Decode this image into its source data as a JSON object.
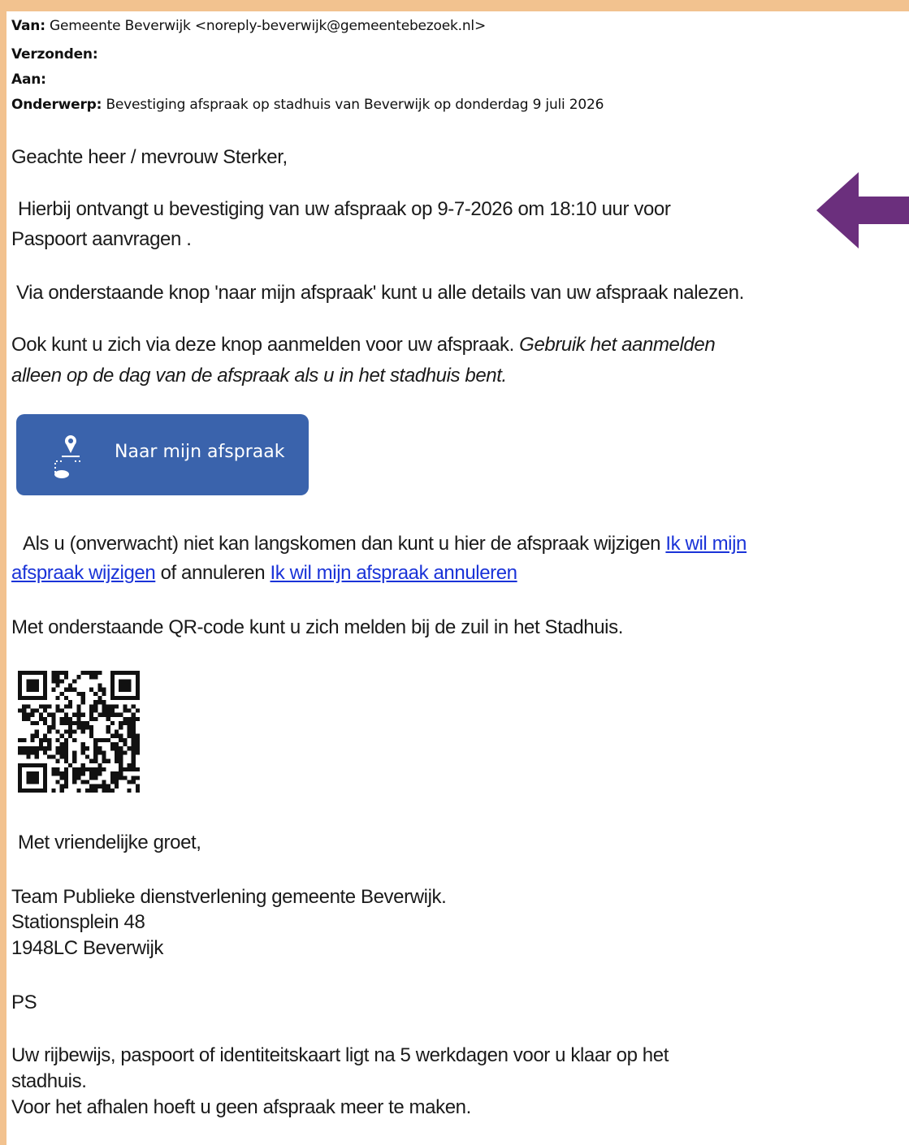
{
  "colors": {
    "frame": "#f2c28f",
    "button": "#3a63ac",
    "arrow": "#6b2f7d",
    "link": "#1a33d8"
  },
  "header": {
    "from_label": "Van:",
    "from_value": "Gemeente Beverwijk <noreply-beverwijk@gemeentebezoek.nl>",
    "sent_label": "Verzonden:",
    "to_label": "Aan:",
    "subject_label": "Onderwerp:",
    "subject_value": "Bevestiging afspraak op stadhuis van Beverwijk op donderdag 9 juli 2026"
  },
  "body": {
    "greeting": "Geachte heer / mevrouw Sterker,",
    "confirm_line1": "Hierbij ontvangt u bevestiging van uw afspraak op 9-7-2026 om 18:10 uur voor",
    "confirm_line2": "Paspoort aanvragen .",
    "via_line": "Via onderstaande knop 'naar mijn afspraak' kunt u alle details van uw afspraak nalezen.",
    "register_plain": "Ook kunt u zich via deze knop aanmelden voor uw afspraak. ",
    "register_italic_1": "Gebruik het aanmelden",
    "register_italic_2": "alleen op de dag van de afspraak als u in het stadhuis bent.",
    "button_label": "Naar mijn afspraak",
    "change_text": "Als u (onverwacht) niet kan langskomen dan kunt u hier de afspraak wijzigen ",
    "change_link_1": "Ik wil mijn",
    "change_link_2": "afspraak wijzigen",
    "cancel_text": " of annuleren ",
    "cancel_link": "Ik wil mijn afspraak annuleren",
    "qr_line": "Met onderstaande QR-code kunt u zich melden bij de zuil in het Stadhuis.",
    "closing": "Met vriendelijke groet,",
    "signature_1": "Team Publieke dienstverlening gemeente Beverwijk.",
    "signature_2": "Stationsplein 48",
    "signature_3": "1948LC Beverwijk",
    "ps": "PS",
    "ps_line1": "Uw rijbewijs, paspoort of identiteitskaart ligt na 5 werkdagen voor u klaar op het",
    "ps_line2": "stadhuis.",
    "ps_line3": "Voor het afhalen hoeft u geen afspraak meer te maken."
  },
  "icons": {
    "button_icon": "location-pin-icon",
    "arrow": "arrow-left-icon",
    "qr": "qr-code"
  }
}
